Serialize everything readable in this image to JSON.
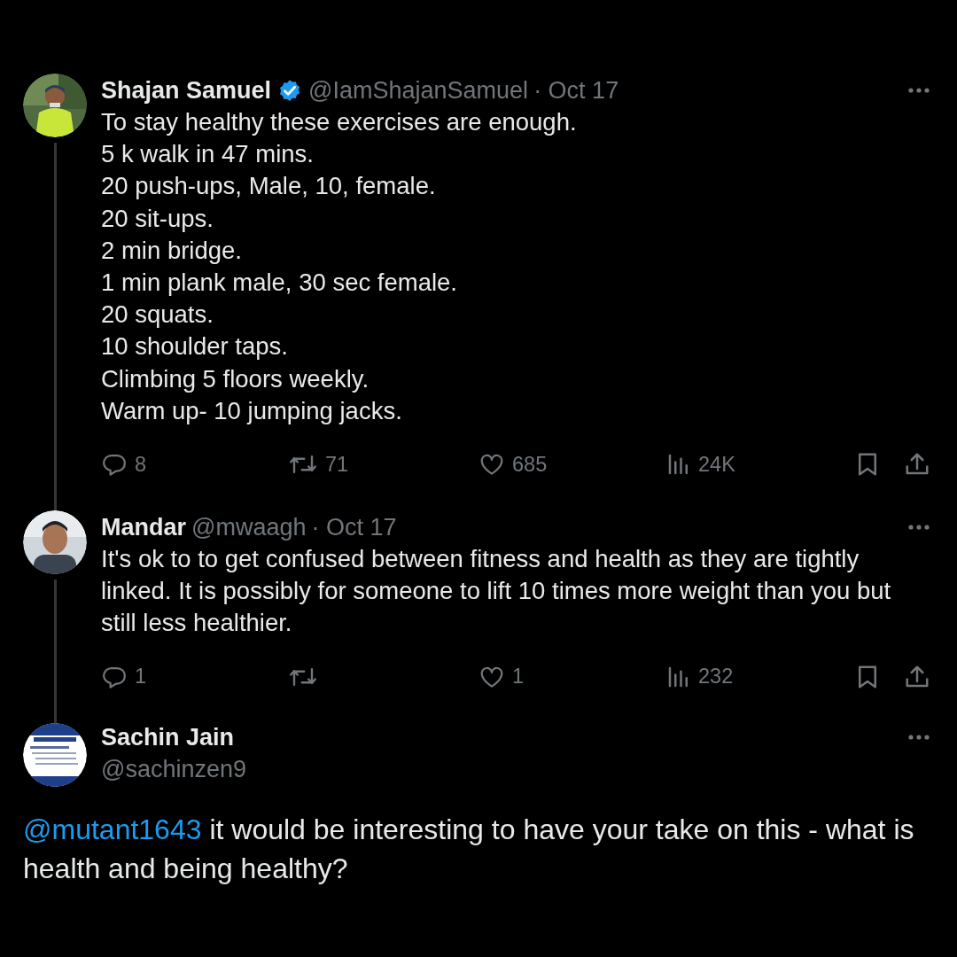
{
  "thread": [
    {
      "name": "Shajan Samuel",
      "verified": true,
      "handle": "@IamShajanSamuel",
      "date": "· Oct 17",
      "connected": true,
      "text": "To stay healthy these exercises are enough.\n5 k walk in 47 mins.\n20 push-ups, Male, 10, female.\n20 sit-ups.\n2 min bridge.\n1 min plank male, 30 sec female.\n20 squats.\n10 shoulder taps.\nClimbing 5 floors weekly.\nWarm up- 10 jumping jacks.",
      "replies": "8",
      "reposts": "71",
      "likes": "685",
      "views": "24K"
    },
    {
      "name": "Mandar",
      "verified": false,
      "handle": "@mwaagh",
      "date": "· Oct 17",
      "connected": true,
      "text": "It's ok to to get confused between fitness and health as they are tightly linked. It is possibly for someone to lift 10 times more weight than you but still less healthier.",
      "replies": "1",
      "likes": "1",
      "views": "232"
    }
  ],
  "focus": {
    "name": "Sachin Jain",
    "handle": "@sachinzen9",
    "mention": "@mutant1643",
    "text": " it would be interesting to have your take on this - what is health and being healthy?"
  }
}
